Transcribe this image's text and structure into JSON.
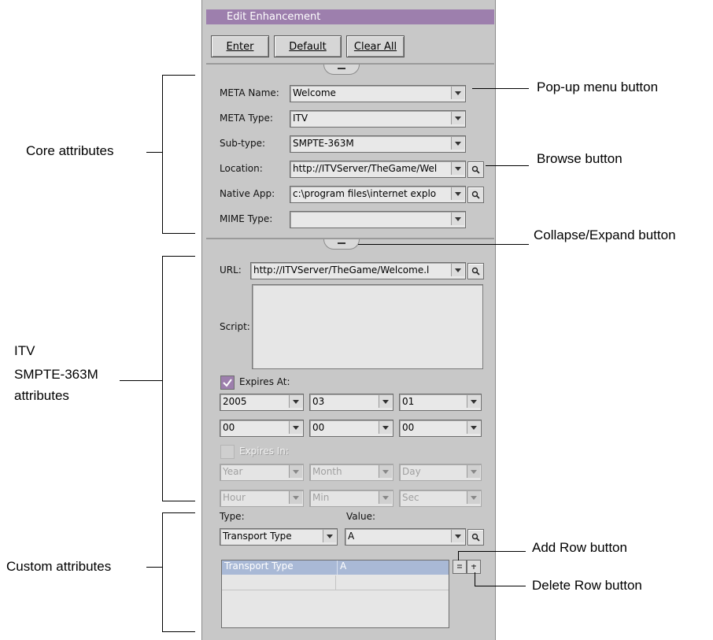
{
  "window": {
    "title": "Edit Enhancement"
  },
  "toolbar": {
    "enter_label": "Enter",
    "default_label": "Default",
    "clear_all_label": "Clear All"
  },
  "core": {
    "meta_name_label": "META Name:",
    "meta_name_value": "Welcome",
    "meta_type_label": "META Type:",
    "meta_type_value": "ITV",
    "subtype_label": "Sub-type:",
    "subtype_value": "SMPTE-363M",
    "location_label": "Location:",
    "location_value": "http://ITVServer/TheGame/Wel",
    "native_app_label": "Native App:",
    "native_app_value": "c:\\program files\\internet explo",
    "mime_type_label": "MIME Type:",
    "mime_type_value": ""
  },
  "itv": {
    "url_label": "URL:",
    "url_value": "http://ITVServer/TheGame/Welcome.l",
    "script_label": "Script:",
    "expires_at_label": "Expires At:",
    "expires_at_checked": true,
    "date_row": [
      "2005",
      "03",
      "01"
    ],
    "time_row": [
      "00",
      "00",
      "00"
    ],
    "expires_in_label": "Expires In:",
    "expires_in_checked": false,
    "in_row1": [
      "Year",
      "Month",
      "Day"
    ],
    "in_row2": [
      "Hour",
      "Min",
      "Sec"
    ]
  },
  "custom": {
    "type_label": "Type:",
    "value_label": "Value:",
    "type_value": "Transport Type",
    "value_value": "A",
    "table_rows": [
      [
        "Transport Type",
        "A"
      ]
    ]
  },
  "callouts": {
    "core": "Core attributes",
    "itv_line1": "ITV",
    "itv_line2": "SMPTE-363M",
    "itv_line3": "attributes",
    "custom": "Custom attributes",
    "popup": "Pop-up menu button",
    "browse": "Browse button",
    "collapse": "Collapse/Expand button",
    "add_row": "Add Row button",
    "delete_row": "Delete Row button"
  },
  "colors": {
    "accent": "#9d7fad",
    "panel": "#c8c8c8",
    "selection": "#a9b9d6"
  }
}
